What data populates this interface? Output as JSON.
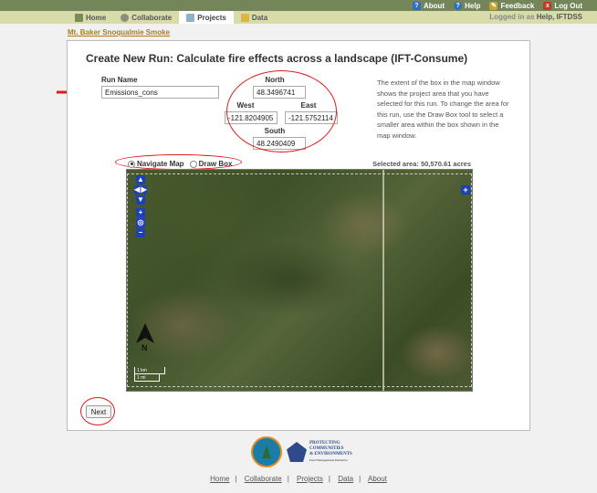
{
  "topbar": {
    "links": [
      {
        "label": "About",
        "icon": "question-icon",
        "color": "#2f6fc0"
      },
      {
        "label": "Help",
        "icon": "help-icon",
        "color": "#2f6fc0"
      },
      {
        "label": "Feedback",
        "icon": "feedback-icon",
        "color": "#c9a52c"
      },
      {
        "label": "Log Out",
        "icon": "logout-icon",
        "color": "#c0392b"
      }
    ]
  },
  "nav": {
    "tabs": [
      {
        "label": "Home",
        "icon": "home-icon"
      },
      {
        "label": "Collaborate",
        "icon": "collaborate-icon"
      },
      {
        "label": "Projects",
        "icon": "projects-icon",
        "active": true
      },
      {
        "label": "Data",
        "icon": "data-icon"
      }
    ],
    "login_prefix": "Logged in as",
    "login_user": "Help, IFTDSS"
  },
  "breadcrumb": "Mt. Baker Snoqualmie Smoke",
  "page": {
    "title": "Create New Run: Calculate fire effects across a landscape (IFT-Consume)",
    "run_name_label": "Run Name",
    "run_name_value": "Emissions_cons",
    "north_label": "North",
    "north_value": "48.3496741",
    "west_label": "West",
    "west_value": "-121.8204905",
    "east_label": "East",
    "east_value": "-121.5752114",
    "south_label": "South",
    "south_value": "48.2490409",
    "help_text": "The extent of the box in the map window shows the project area that you have selected for this run. To change the area for this run, use the Draw Box tool to select a smaller area within the box shown in the map window.",
    "radio_navigate": "Navigate Map",
    "radio_draw": "Draw Box",
    "selected_area": "Selected area: 50,570.61 acres",
    "scale_km": "1 km",
    "scale_mi": "1 mi",
    "north_arrow_letter": "N",
    "next_label": "Next"
  },
  "logos": {
    "pce_line1": "PROTECTING",
    "pce_line2": "COMMUNITIES",
    "pce_line3": "& ENVIRONMENTS",
    "pce_sub": "Fuel Management Initiative"
  },
  "footer": {
    "links": [
      "Home",
      "Collaborate",
      "Projects",
      "Data",
      "About"
    ]
  },
  "colors": {
    "topbar": "#74855a",
    "navbar": "#d8dcab",
    "annotation": "#e11919",
    "breadcrumb": "#b07a1f",
    "map_controls": "#1c3fbf"
  }
}
